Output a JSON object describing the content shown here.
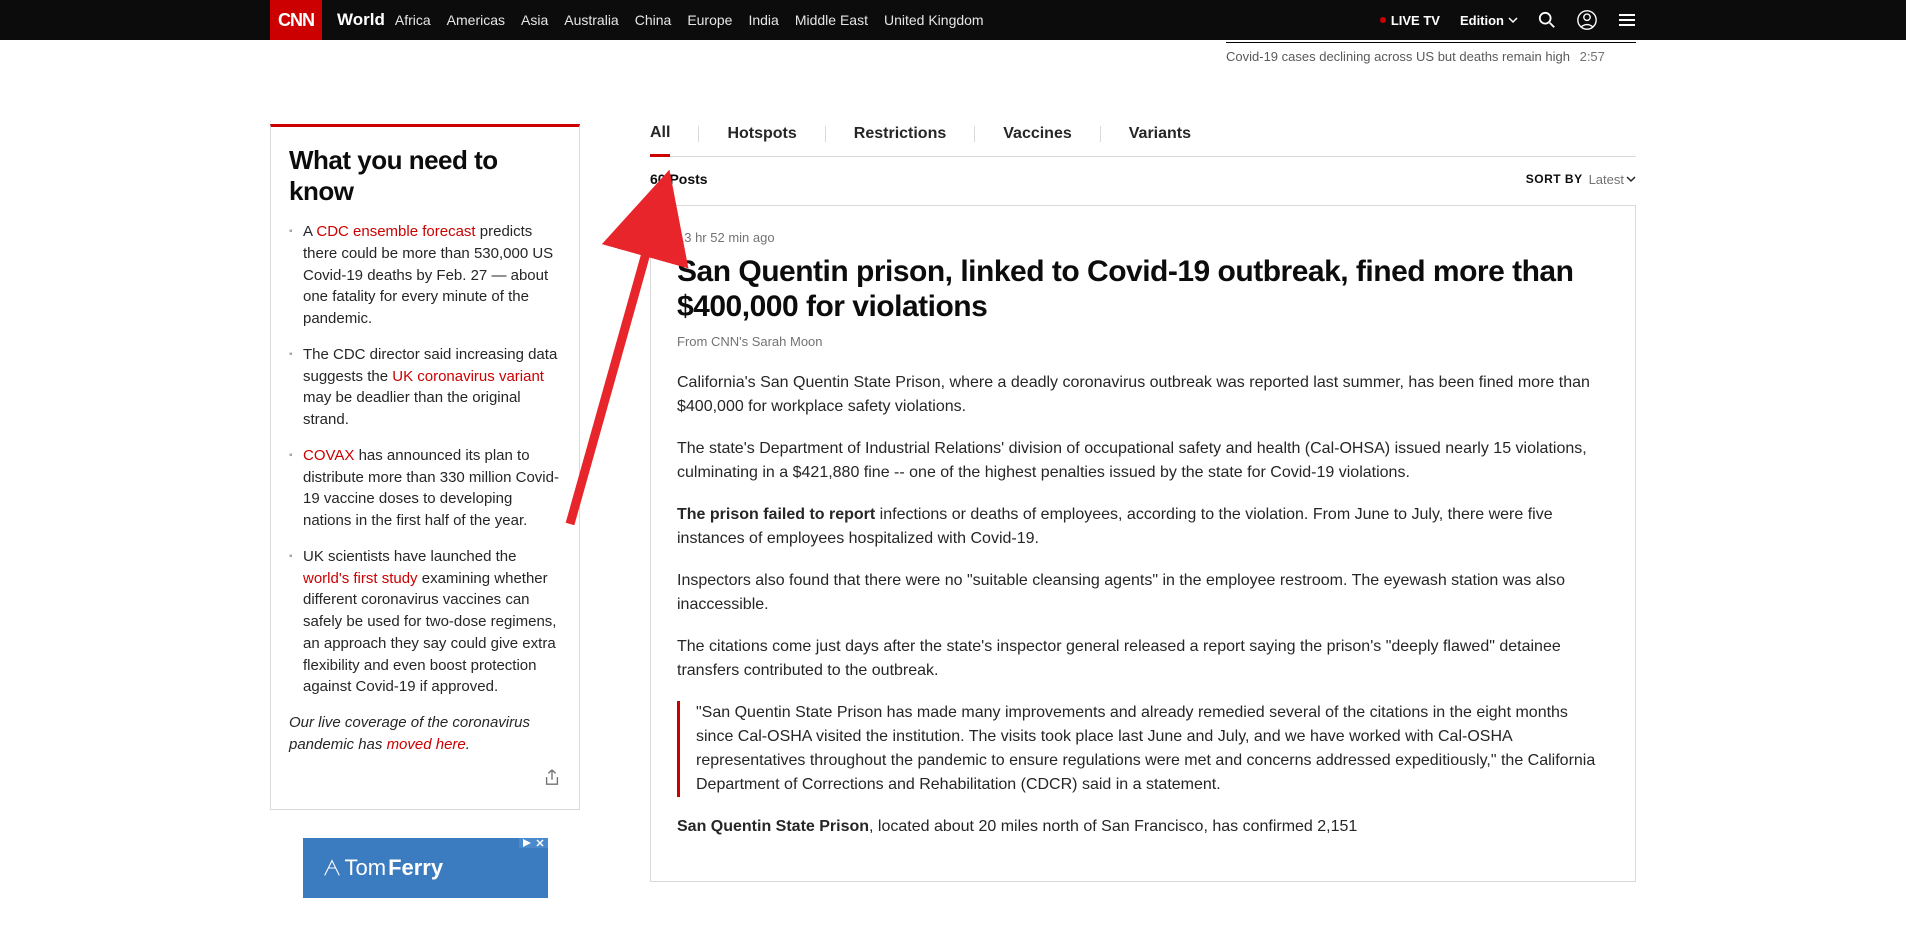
{
  "header": {
    "logo": "CNN",
    "section": "World",
    "nav": [
      "Africa",
      "Americas",
      "Asia",
      "Australia",
      "China",
      "Europe",
      "India",
      "Middle East",
      "United Kingdom"
    ],
    "live_tv": "LIVE TV",
    "edition": "Edition"
  },
  "video_strip": {
    "caption": "Covid-19 cases declining across US but deaths remain high",
    "duration": "2:57"
  },
  "sidebar": {
    "title": "What you need to know",
    "items": [
      {
        "pre": "A ",
        "link": "CDC ensemble forecast",
        "post": " predicts there could be more than 530,000 US Covid-19 deaths by Feb. 27 — about one fatality for every minute of the pandemic."
      },
      {
        "pre": "The CDC director said increasing data suggests the ",
        "link": "UK coronavirus variant",
        "post": " may be deadlier than the original strand."
      },
      {
        "pre": "",
        "link": "COVAX",
        "post": " has announced its plan to distribute more than 330 million Covid-19 vaccine doses to developing nations in the first half of the year."
      },
      {
        "pre": "UK scientists have launched the ",
        "link": "world's first study",
        "post": " examining whether different coronavirus vaccines can safely be used for two-dose regimens, an approach they say could give extra flexibility and even boost protection against Covid-19 if approved."
      }
    ],
    "footer_pre": "Our live coverage of the coronavirus pandemic has ",
    "footer_link": "moved here",
    "footer_post": "."
  },
  "ad": {
    "text_light": "Tom",
    "text_bold": "Ferry"
  },
  "tabs": [
    "All",
    "Hotspots",
    "Restrictions",
    "Vaccines",
    "Variants"
  ],
  "posts_count": "60 Posts",
  "sort": {
    "label": "SORT BY",
    "value": "Latest"
  },
  "article": {
    "timestamp": "13 hr 52 min ago",
    "title": "San Quentin prison, linked to Covid-19 outbreak, fined more than $400,000 for violations",
    "byline": "From CNN's Sarah Moon",
    "paragraphs": [
      "California's San Quentin State Prison, where a deadly coronavirus outbreak was reported last summer, has been fined more than $400,000 for workplace safety violations.",
      "The state's Department of Industrial Relations' division of occupational safety and health (Cal-OHSA) issued nearly 15 violations, culminating in a $421,880 fine -- one of the highest penalties issued by the state for Covid-19 violations."
    ],
    "p3_strong": "The prison failed to report",
    "p3_rest": " infections or deaths of employees, according to the violation. From June to July, there were five instances of employees hospitalized with Covid-19.",
    "paragraphs2": [
      "Inspectors also found that there were no \"suitable cleansing agents\" in the employee restroom. The eyewash station was also inaccessible.",
      "The citations come just days after the state's inspector general released a report saying the prison's \"deeply flawed\" detainee transfers contributed to the outbreak."
    ],
    "quote": "\"San Quentin State Prison has made many improvements and already remedied several of the citations in the eight months since Cal-OSHA visited the institution. The visits took place last June and July, and we have worked with Cal-OSHA representatives throughout the pandemic to ensure regulations were met and concerns addressed expeditiously,\" the California Department of Corrections and Rehabilitation (CDCR) said in a statement.",
    "p_trail_strong": "San Quentin State Prison",
    "p_trail_rest": ", located about 20 miles north of San Francisco, has confirmed 2,151"
  }
}
